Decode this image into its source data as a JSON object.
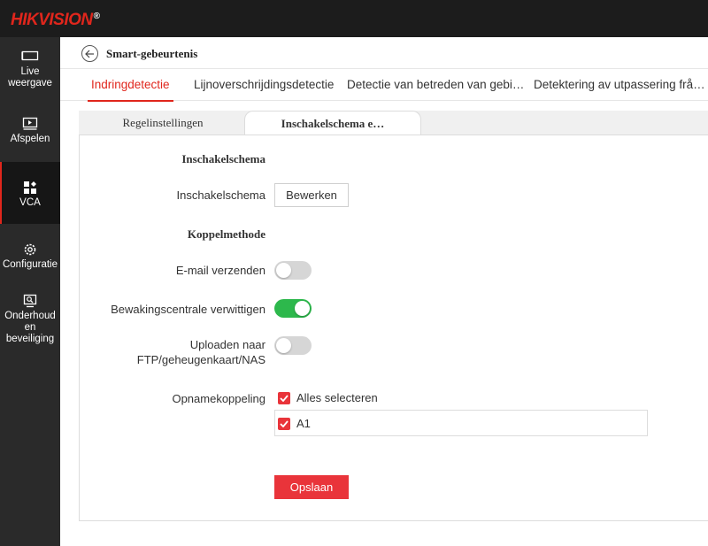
{
  "brand": {
    "name": "HIKVISION",
    "mark": "®"
  },
  "sidebar": {
    "items": [
      {
        "label": "Live weergave",
        "icon": "monitor-icon"
      },
      {
        "label": "Afspelen",
        "icon": "playback-icon"
      },
      {
        "label": "VCA",
        "icon": "vca-icon",
        "active": true
      },
      {
        "label": "Configuratie",
        "icon": "gear-icon"
      },
      {
        "label": "Onderhoud en beveiliging",
        "icon": "maintenance-icon"
      }
    ]
  },
  "header": {
    "title": "Smart-gebeurtenis",
    "back_icon": "back-arrow-icon"
  },
  "tabs": [
    {
      "label": "Indringdetectie",
      "active": true
    },
    {
      "label": "Lijnoverschrijdingsdetectie"
    },
    {
      "label": "Detectie van betreden van gebi…"
    },
    {
      "label": "Detektering av utpassering frå…"
    }
  ],
  "subtabs": [
    {
      "label": "Regelinstellingen"
    },
    {
      "label": "Inschakelschema e…",
      "selected": true
    }
  ],
  "form": {
    "section_schedule": "Inschakelschema",
    "schedule_label": "Inschakelschema",
    "edit_button": "Bewerken",
    "section_linkage": "Koppelmethode",
    "email_label": "E-mail verzenden",
    "email_on": false,
    "center_label": "Bewakingscentrale verwittigen",
    "center_on": true,
    "upload_label_1": "Uploaden naar",
    "upload_label_2": "FTP/geheugenkaart/NAS",
    "upload_on": false,
    "record_label": "Opnamekoppeling",
    "select_all_label": "Alles selecteren",
    "select_all_checked": true,
    "channels": [
      {
        "label": "A1",
        "checked": true
      }
    ],
    "save_button": "Opslaan"
  },
  "colors": {
    "accent": "#e0261c",
    "toggle_on": "#2db84c",
    "primary_button": "#e9343a",
    "sidebar": "#2a2a2a"
  }
}
